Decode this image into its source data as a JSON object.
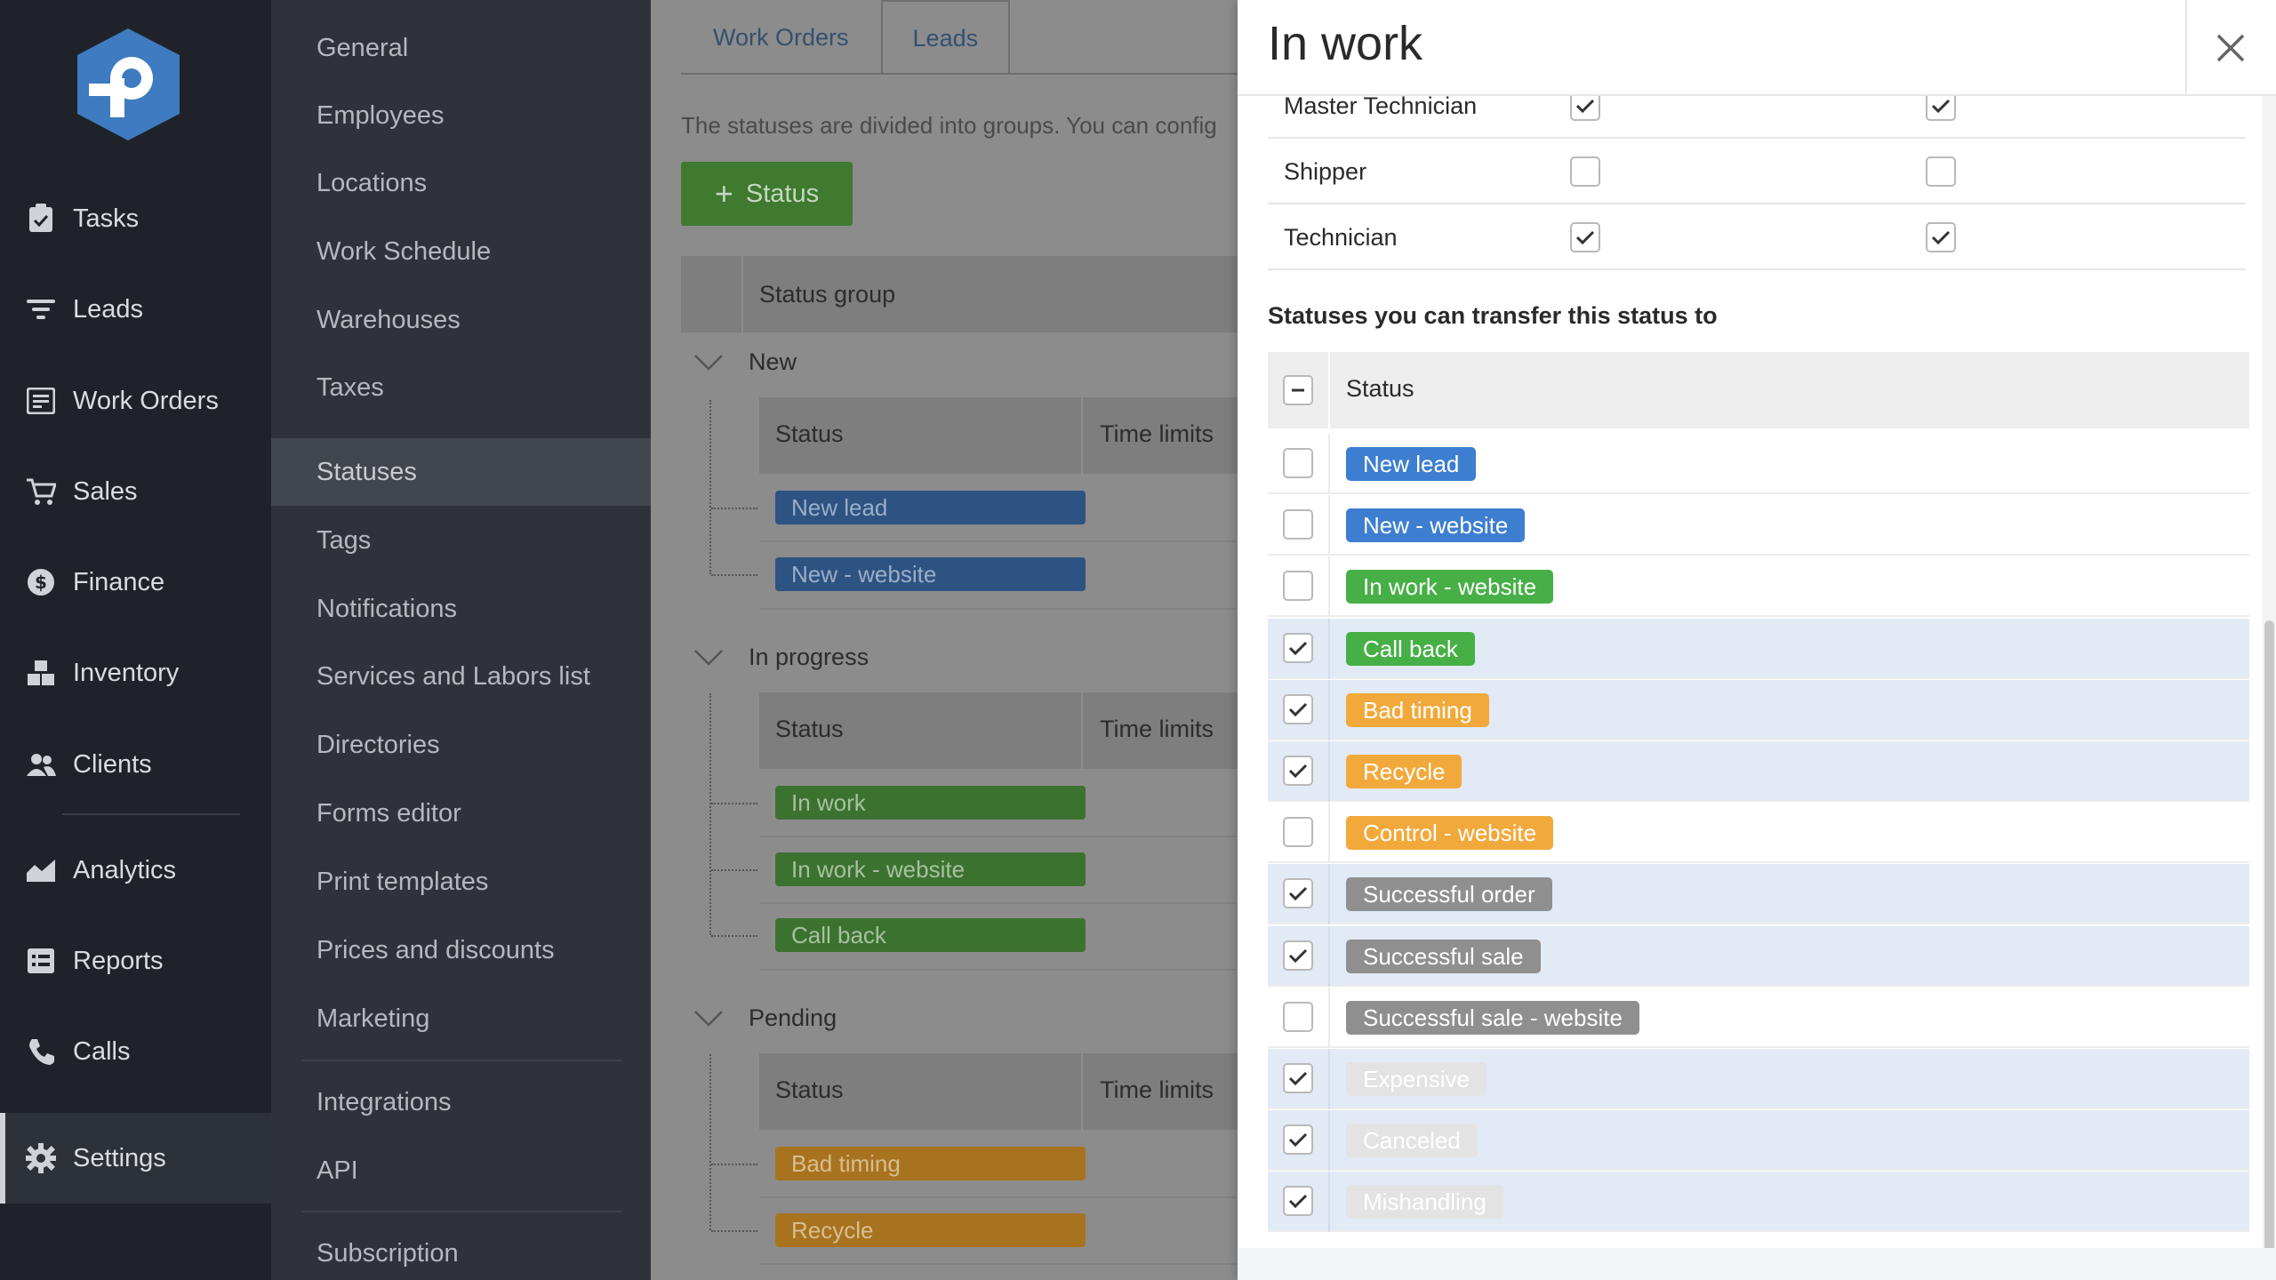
{
  "nav": {
    "items": [
      {
        "label": "Tasks",
        "icon": "clipboard-icon"
      },
      {
        "label": "Leads",
        "icon": "filter-icon"
      },
      {
        "label": "Work Orders",
        "icon": "work-order-icon"
      },
      {
        "label": "Sales",
        "icon": "cart-icon"
      },
      {
        "label": "Finance",
        "icon": "dollar-icon"
      },
      {
        "label": "Inventory",
        "icon": "boxes-icon"
      },
      {
        "label": "Clients",
        "icon": "clients-icon"
      },
      {
        "label": "Analytics",
        "icon": "analytics-icon"
      },
      {
        "label": "Reports",
        "icon": "reports-icon"
      },
      {
        "label": "Calls",
        "icon": "phone-icon"
      },
      {
        "label": "Settings",
        "icon": "gear-icon"
      }
    ]
  },
  "settings_menu": {
    "items": [
      "General",
      "Employees",
      "Locations",
      "Work Schedule",
      "Warehouses",
      "Taxes",
      "Statuses",
      "Tags",
      "Notifications",
      "Services and Labors list",
      "Directories",
      "Forms editor",
      "Print templates",
      "Prices and discounts",
      "Marketing",
      "Integrations",
      "API",
      "Subscription"
    ],
    "active": "Statuses"
  },
  "main": {
    "tabs": [
      "Work Orders",
      "Leads"
    ],
    "active_tab": "Leads",
    "intro": "The statuses are divided into groups. You can config",
    "add_button": "Status",
    "table_header": "Status group",
    "col_status": "Status",
    "col_time_limits": "Time limits",
    "groups": [
      {
        "title": "New",
        "statuses": [
          "New lead",
          "New - website"
        ]
      },
      {
        "title": "In progress",
        "statuses": [
          "In work",
          "In work - website",
          "Call back"
        ]
      },
      {
        "title": "Pending",
        "statuses": [
          "Bad timing",
          "Recycle"
        ]
      }
    ]
  },
  "panel": {
    "title": "In work",
    "roles": [
      {
        "label": "Master Technician",
        "a": true,
        "b": true
      },
      {
        "label": "Shipper",
        "a": false,
        "b": false
      },
      {
        "label": "Technician",
        "a": true,
        "b": true
      }
    ],
    "transfer_title": "Statuses you can transfer this status to",
    "transfer_header": "Status",
    "statuses": [
      {
        "label": "New lead",
        "color": "blue",
        "checked": false
      },
      {
        "label": "New - website",
        "color": "blue",
        "checked": false
      },
      {
        "label": "In work - website",
        "color": "green",
        "checked": false
      },
      {
        "label": "Call back",
        "color": "green",
        "checked": true
      },
      {
        "label": "Bad timing",
        "color": "orange",
        "checked": true
      },
      {
        "label": "Recycle",
        "color": "orange",
        "checked": true
      },
      {
        "label": "Control - website",
        "color": "orange",
        "checked": false
      },
      {
        "label": "Successful order",
        "color": "gray",
        "checked": true
      },
      {
        "label": "Successful sale",
        "color": "gray",
        "checked": true
      },
      {
        "label": "Successful sale - website",
        "color": "gray",
        "checked": false
      },
      {
        "label": "Expensive",
        "color": "light",
        "checked": true
      },
      {
        "label": "Canceled",
        "color": "light",
        "checked": true
      },
      {
        "label": "Mishandling",
        "color": "light",
        "checked": true
      }
    ]
  },
  "colors": {
    "blue": "#3d7ed0",
    "green": "#46b046",
    "orange": "#f2a93b",
    "gray": "#8f8f8f",
    "light": "#e3e3e3",
    "selected_row": "#e2eaf6"
  }
}
